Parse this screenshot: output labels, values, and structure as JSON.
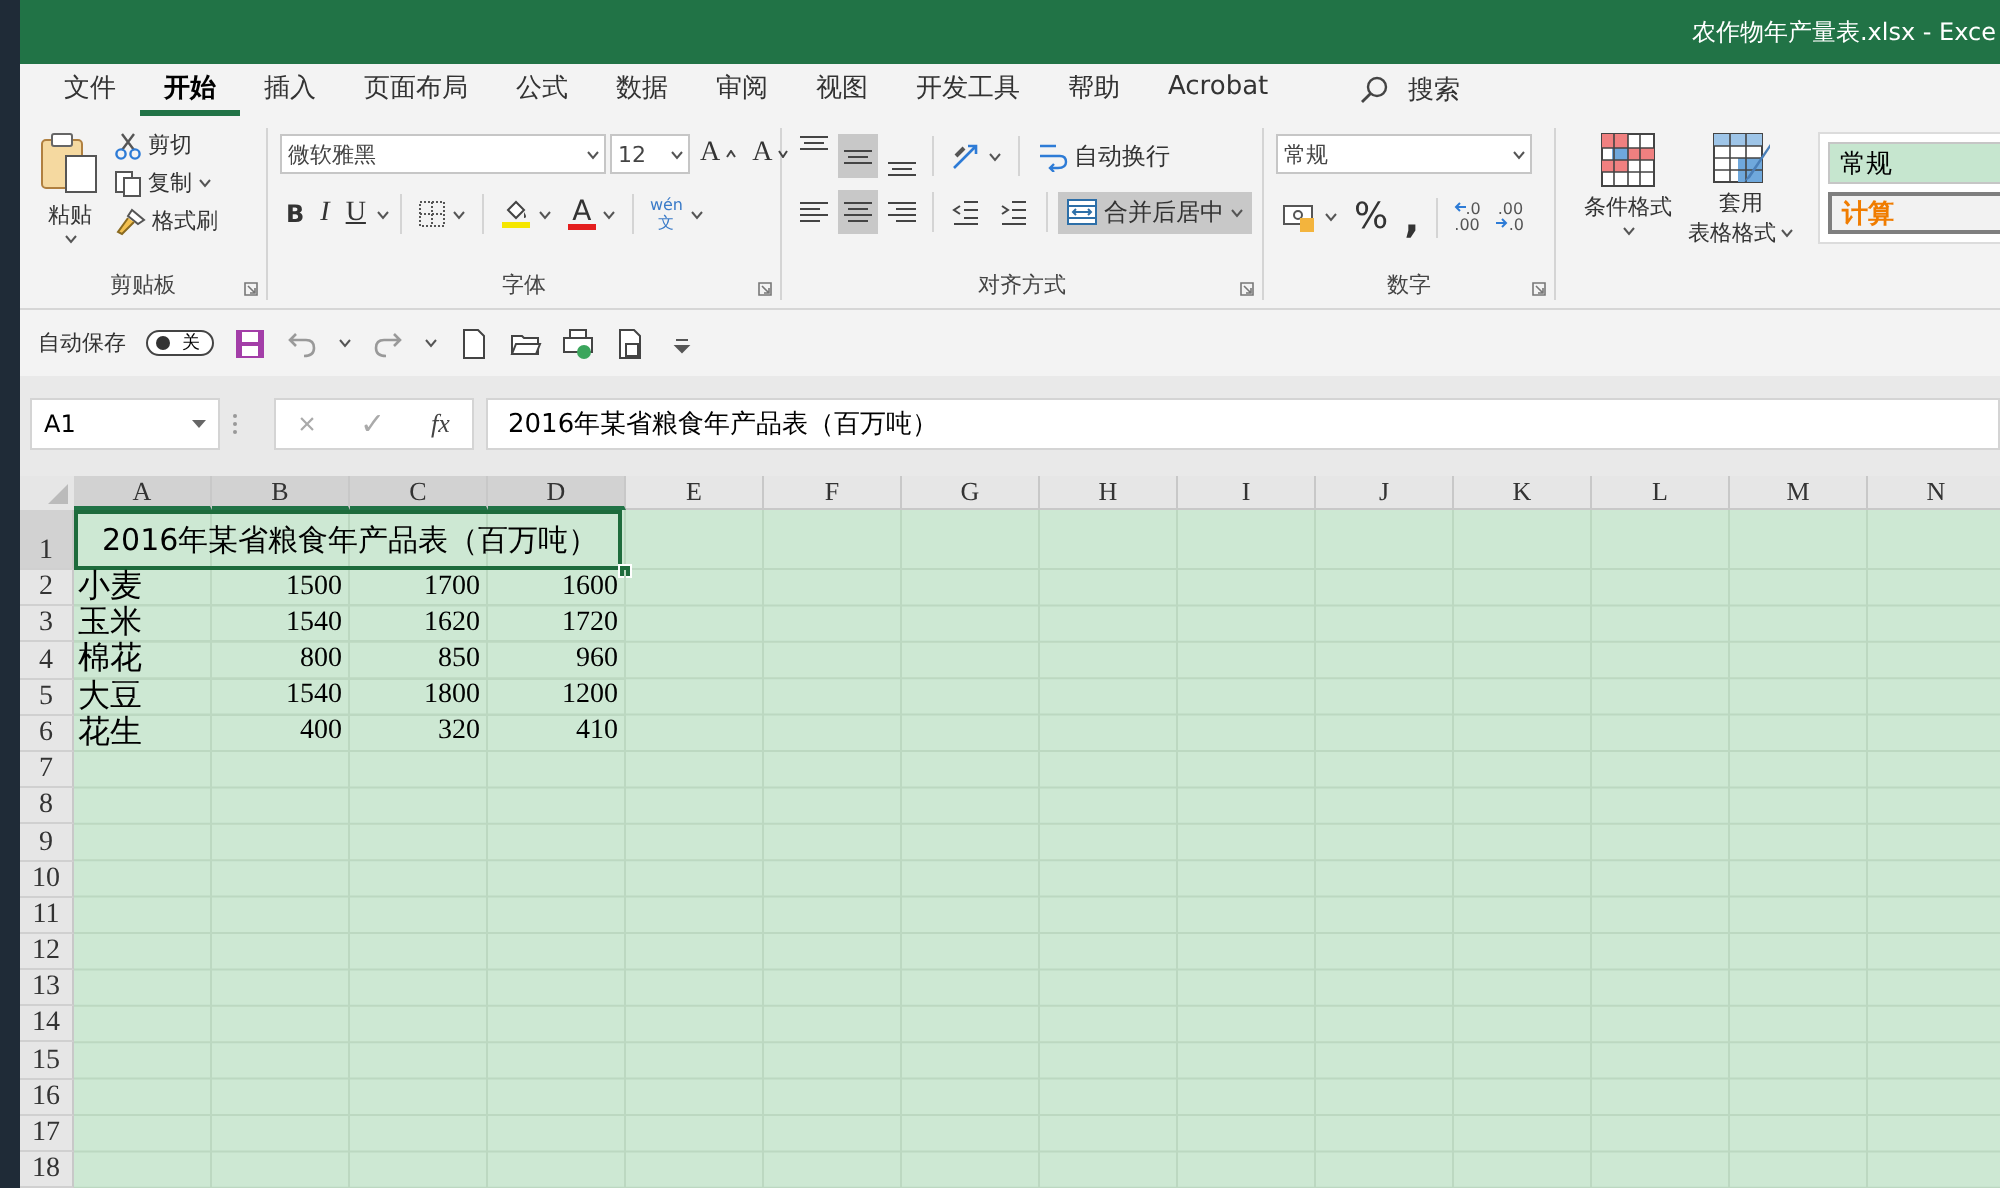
{
  "window": {
    "title": "农作物年产量表.xlsx  -  Exce"
  },
  "tabs": [
    {
      "label": "文件",
      "selected": false
    },
    {
      "label": "开始",
      "selected": true
    },
    {
      "label": "插入",
      "selected": false
    },
    {
      "label": "页面布局",
      "selected": false
    },
    {
      "label": "公式",
      "selected": false
    },
    {
      "label": "数据",
      "selected": false
    },
    {
      "label": "审阅",
      "selected": false
    },
    {
      "label": "视图",
      "selected": false
    },
    {
      "label": "开发工具",
      "selected": false
    },
    {
      "label": "帮助",
      "selected": false
    },
    {
      "label": "Acrobat",
      "selected": false
    }
  ],
  "search": {
    "label": "搜索"
  },
  "ribbon": {
    "clipboard": {
      "title": "剪贴板",
      "paste": "粘贴",
      "cut": "剪切",
      "copy": "复制",
      "format_painter": "格式刷"
    },
    "font": {
      "title": "字体",
      "font_name": "微软雅黑",
      "font_size": "12",
      "grow": "A",
      "shrink": "A",
      "bold": "B",
      "italic": "I",
      "underline": "U",
      "font_color": "A",
      "phonetic": {
        "top": "wén",
        "bottom": "文"
      }
    },
    "alignment": {
      "title": "对齐方式",
      "vertical": [
        {
          "kind": "top",
          "selected": false
        },
        {
          "kind": "middle",
          "selected": true
        },
        {
          "kind": "bottom",
          "selected": false
        }
      ],
      "horizontal": [
        {
          "kind": "left",
          "selected": false
        },
        {
          "kind": "center",
          "selected": true
        },
        {
          "kind": "right",
          "selected": false
        }
      ],
      "wrap_text": {
        "label": "自动换行",
        "selected": false
      },
      "merge_center": {
        "label": "合并后居中",
        "selected": true
      }
    },
    "number": {
      "title": "数字",
      "format": "常规",
      "percent": "%",
      "comma": ",",
      "decimals": [
        {
          "kind": "increase",
          "top": ".0",
          "bottom": ".00"
        },
        {
          "kind": "decrease",
          "top": ".00",
          "bottom": ".0"
        }
      ]
    },
    "styles": {
      "conditional_format": "条件格式",
      "table_format": [
        "套用",
        "表格格式"
      ],
      "cell_styles": [
        {
          "kind": "normal",
          "label": "常规"
        },
        {
          "kind": "calculation",
          "label": "计算"
        }
      ]
    }
  },
  "quick_access": {
    "autosave_label": "自动保存",
    "autosave": {
      "on": false,
      "label": "关"
    }
  },
  "formula_bar": {
    "name_box": "A1",
    "cancel": "×",
    "enter": "✓",
    "function": "fx",
    "formula": "2016年某省粮食年产品表（百万吨）"
  },
  "grid": {
    "columns": [
      {
        "label": "A",
        "selected": true
      },
      {
        "label": "B",
        "selected": true
      },
      {
        "label": "C",
        "selected": true
      },
      {
        "label": "D",
        "selected": true
      },
      {
        "label": "E",
        "selected": false
      },
      {
        "label": "F",
        "selected": false
      },
      {
        "label": "G",
        "selected": false
      },
      {
        "label": "H",
        "selected": false
      },
      {
        "label": "I",
        "selected": false
      },
      {
        "label": "J",
        "selected": false
      },
      {
        "label": "K",
        "selected": false
      },
      {
        "label": "L",
        "selected": false
      },
      {
        "label": "M",
        "selected": false
      },
      {
        "label": "N",
        "selected": false
      }
    ],
    "rows": [
      {
        "label": "1",
        "selected": true,
        "kind": "title",
        "cells": [
          "2016年某省粮食年产品表（百万吨）"
        ]
      },
      {
        "label": "2",
        "selected": false,
        "kind": "data",
        "cells": [
          "小麦",
          "1500",
          "1700",
          "1600"
        ]
      },
      {
        "label": "3",
        "selected": false,
        "kind": "data",
        "cells": [
          "玉米",
          "1540",
          "1620",
          "1720"
        ]
      },
      {
        "label": "4",
        "selected": false,
        "kind": "data",
        "cells": [
          "棉花",
          "800",
          "850",
          "960"
        ]
      },
      {
        "label": "5",
        "selected": false,
        "kind": "data",
        "cells": [
          "大豆",
          "1540",
          "1800",
          "1200"
        ]
      },
      {
        "label": "6",
        "selected": false,
        "kind": "data",
        "cells": [
          "花生",
          "400",
          "320",
          "410"
        ]
      },
      {
        "label": "7",
        "selected": false,
        "kind": "empty"
      },
      {
        "label": "8",
        "selected": false,
        "kind": "empty"
      },
      {
        "label": "9",
        "selected": false,
        "kind": "empty"
      },
      {
        "label": "10",
        "selected": false,
        "kind": "empty"
      },
      {
        "label": "11",
        "selected": false,
        "kind": "empty"
      },
      {
        "label": "12",
        "selected": false,
        "kind": "empty"
      },
      {
        "label": "13",
        "selected": false,
        "kind": "empty"
      },
      {
        "label": "14",
        "selected": false,
        "kind": "empty"
      },
      {
        "label": "15",
        "selected": false,
        "kind": "empty"
      },
      {
        "label": "16",
        "selected": false,
        "kind": "empty"
      },
      {
        "label": "17",
        "selected": false,
        "kind": "empty"
      },
      {
        "label": "18",
        "selected": false,
        "kind": "empty"
      }
    ]
  }
}
